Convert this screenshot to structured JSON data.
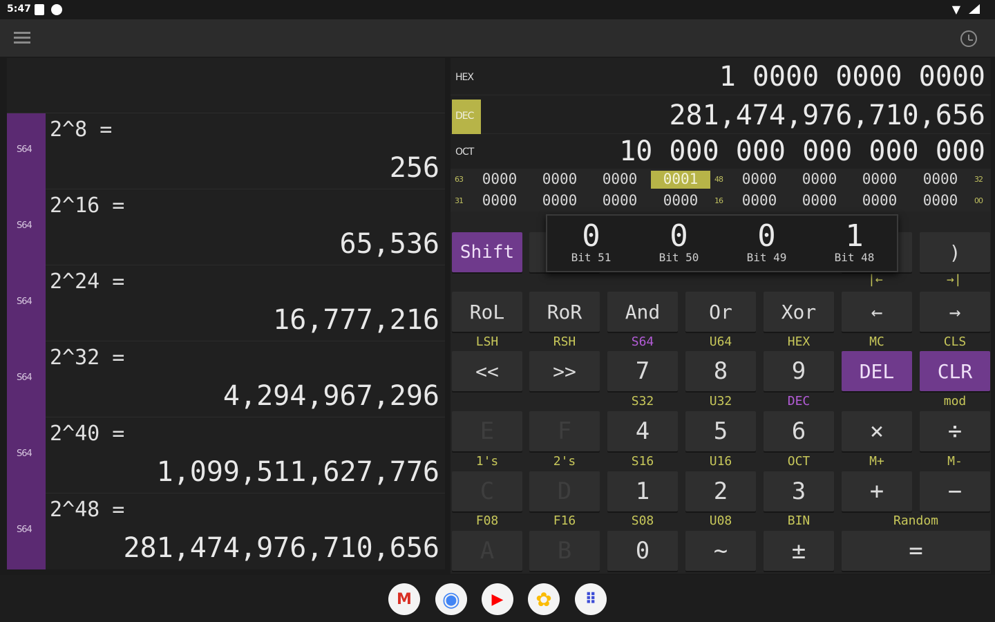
{
  "status": {
    "time": "5:47"
  },
  "history": [
    {
      "tag": "S64",
      "expr": "2^8 =",
      "result": "256"
    },
    {
      "tag": "S64",
      "expr": "2^16 =",
      "result": "65,536"
    },
    {
      "tag": "S64",
      "expr": "2^24 =",
      "result": "16,777,216"
    },
    {
      "tag": "S64",
      "expr": "2^32 =",
      "result": "4,294,967,296"
    },
    {
      "tag": "S64",
      "expr": "2^40 =",
      "result": "1,099,511,627,776"
    },
    {
      "tag": "S64",
      "expr": "2^48 =",
      "result": "281,474,976,710,656"
    }
  ],
  "display": {
    "hex": {
      "label": "HEX",
      "value": "1 0000 0000 0000"
    },
    "dec": {
      "label": "DEC",
      "value": "281,474,976,710,656"
    },
    "oct": {
      "label": "OCT",
      "value": "10 000 000 000 000 000"
    }
  },
  "bits": {
    "row1": {
      "left": "63",
      "mid": "48",
      "right": "32",
      "cells": [
        "0000",
        "0000",
        "0000",
        "0001",
        "0000",
        "0000",
        "0000",
        "0000"
      ]
    },
    "row2": {
      "left": "31",
      "mid": "16",
      "right": "00",
      "cells": [
        "0000",
        "0000",
        "0000",
        "0000",
        "0000",
        "0000",
        "0000",
        "0000"
      ]
    }
  },
  "popup": [
    {
      "value": "0",
      "label": "Bit 51"
    },
    {
      "value": "0",
      "label": "Bit 50"
    },
    {
      "value": "0",
      "label": "Bit 49"
    },
    {
      "value": "1",
      "label": "Bit 48"
    }
  ],
  "keys": {
    "shift": "Shift",
    "close_paren": ")",
    "home_nav": "|←",
    "end_nav": "→|",
    "rol": "RoL",
    "ror": "RoR",
    "and": "And",
    "or": "Or",
    "xor": "Xor",
    "left": "←",
    "right": "→",
    "lsh": "<<",
    "rsh": ">>",
    "k7": "7",
    "k8": "8",
    "k9": "9",
    "del": "DEL",
    "clr": "CLR",
    "e": "E",
    "f": "F",
    "k4": "4",
    "k5": "5",
    "k6": "6",
    "mul": "×",
    "div": "÷",
    "c": "C",
    "d": "D",
    "k1": "1",
    "k2": "2",
    "k3": "3",
    "plus": "+",
    "minus": "−",
    "a": "A",
    "b": "B",
    "k0": "0",
    "not": "~",
    "neg": "±",
    "eq": "="
  },
  "sub": {
    "lsh": "LSH",
    "rsh": "RSH",
    "s64": "S64",
    "u64": "U64",
    "hex": "HEX",
    "mc": "MC",
    "cls": "CLS",
    "s32": "S32",
    "u32": "U32",
    "dec": "DEC",
    "mod": "mod",
    "ones": "1's",
    "twos": "2's",
    "s16": "S16",
    "u16": "U16",
    "oct": "OCT",
    "mplus": "M+",
    "mminus": "M-",
    "f08": "F08",
    "f16": "F16",
    "s08": "S08",
    "u08": "U08",
    "bin": "BIN",
    "random": "Random"
  },
  "taskbar": {
    "gmail": "M",
    "chrome": "◉",
    "youtube": "▶",
    "photos": "✿",
    "apps": "⠿"
  },
  "colors": {
    "accent_purple": "#6f3a8c",
    "accent_yellow": "#b7b448"
  }
}
